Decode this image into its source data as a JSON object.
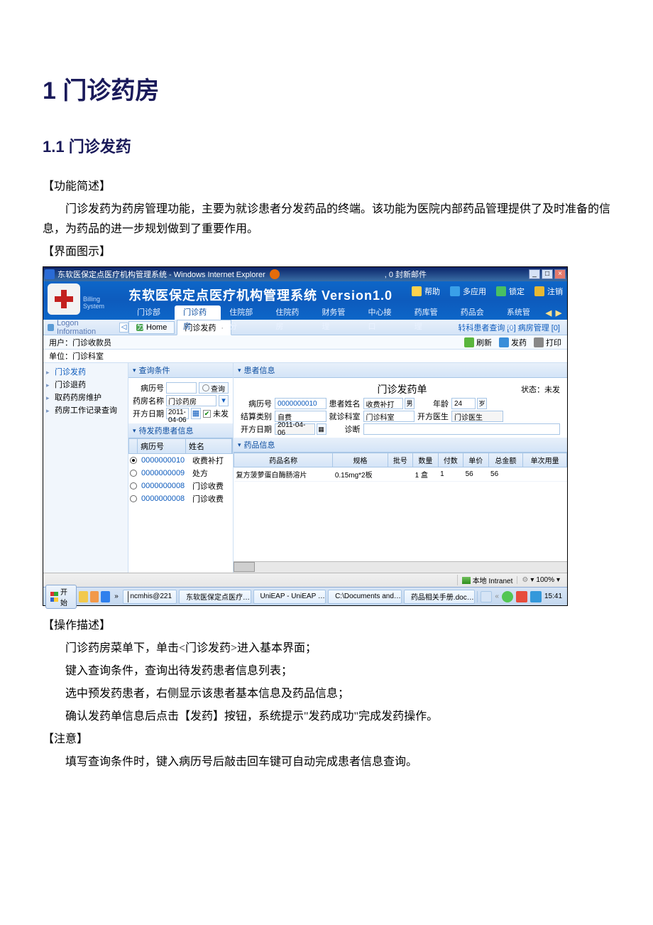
{
  "page_title": "1 门诊药房",
  "section_title": "1.1 门诊发药",
  "headings": {
    "func_intro": "【功能简述】",
    "ui_demo": "【界面图示】",
    "op_desc": "【操作描述】",
    "note": "【注意】"
  },
  "paragraphs": {
    "func_p1": "门诊发药为药房管理功能，主要为就诊患者分发药品的终端。该功能为医院内部药品管理提供了及时准备的信息，为药品的进一步规划做到了重要作用。",
    "op_1": "门诊药房菜单下，单击<门诊发药>进入基本界面；",
    "op_2": "键入查询条件，查询出待发药患者信息列表；",
    "op_3": "选中预发药患者，右侧显示该患者基本信息及药品信息；",
    "op_4": "确认发药单信息后点击【发药】按钮，系统提示\"发药成功\"完成发药操作。",
    "note_1": "填写查询条件时，键入病历号后敲击回车键可自动完成患者信息查询。"
  },
  "screenshot": {
    "titlebar": {
      "app_title": "东软医保定点医疗机构管理系统 - Windows Internet Explorer",
      "center_note": ", 0 封新邮件",
      "buttons": {
        "min": "_",
        "max": "□",
        "close": "×"
      }
    },
    "banner": {
      "billing_text1": "Billing",
      "billing_text2": "System",
      "main_title": "东软医保定点医疗机构管理系统  Version1.0",
      "actions": {
        "help": "帮助",
        "more_apps": "多应用",
        "lock": "锁定",
        "logout": "注销"
      },
      "menu": [
        "门诊部分",
        "门诊药房",
        "住院部分",
        "住院药房",
        "财务管理",
        "中心接口",
        "药库管理",
        "药品会计",
        "系统管理"
      ],
      "menu_selected_index": 1
    },
    "tabrow": {
      "logon_label": "Logon Information",
      "home_tab": "Home",
      "active_tab": "门诊发药",
      "right_links": "转科患者查询 [0]  病房管理 [0]"
    },
    "infobar": {
      "user_label": "用户：门诊收款员",
      "unit_label": "单位：门诊科室",
      "refresh": "刷新",
      "dispense": "发药",
      "print": "打印"
    },
    "sidebar": {
      "items": [
        "门诊发药",
        "门诊退药",
        "取药药房维护",
        "药房工作记录查询"
      ],
      "selected_index": 0
    },
    "query": {
      "panel_title": "查询条件",
      "q_btn": "查询",
      "labels": {
        "mrn": "病历号",
        "pharmacy": "药房名称",
        "date": "开方日期",
        "not_disp": "未发"
      },
      "values": {
        "mrn": "",
        "pharmacy": "门诊药房",
        "date": "2011-04-06",
        "not_disp_checked": true
      }
    },
    "patient_list": {
      "panel_title": "待发药患者信息",
      "headers": [
        "病历号",
        "姓名"
      ],
      "rows": [
        {
          "selected": true,
          "mrn": "0000000010",
          "name": "收费补打"
        },
        {
          "selected": false,
          "mrn": "0000000009",
          "name": "处方"
        },
        {
          "selected": false,
          "mrn": "0000000008",
          "name": "门诊收费"
        },
        {
          "selected": false,
          "mrn": "0000000008",
          "name": "门诊收费"
        }
      ]
    },
    "patient_panel": {
      "panel_title": "患者信息",
      "form_title": "门诊发药单",
      "status": "状态：未发",
      "labels": {
        "mrn": "病历号",
        "name": "患者姓名",
        "age": "年龄",
        "pay_type": "结算类别",
        "dept": "就诊科室",
        "doctor": "开方医生",
        "date": "开方日期",
        "diag": "诊断"
      },
      "values": {
        "mrn": "0000000010",
        "name": "收费补打",
        "age": "24",
        "sex": "男",
        "pay_type": "自费",
        "dept": "门诊科室",
        "doctor": "门诊医生",
        "date": "2011-04-06",
        "diag": ""
      }
    },
    "drug_panel": {
      "panel_title": "药品信息",
      "headers": [
        "药品名称",
        "规格",
        "批号",
        "数量",
        "付数",
        "单价",
        "总金额",
        "单次用量"
      ],
      "row": {
        "name": "复方菠萝蛋白酶肠溶片",
        "spec": "0.15mg*2板",
        "batch": "",
        "qty": "1 盒",
        "times": "1",
        "price": "56",
        "total": "56",
        "dose": ""
      }
    },
    "statusbar": {
      "zone": "本地 Intranet",
      "zoom": "100%"
    },
    "taskbar": {
      "start": "开始",
      "host": "ncmhis@221",
      "items": [
        "东软医保定点医疗…",
        "UniEAP - UniEAP …",
        "C:\\Documents and…",
        "药品相关手册.doc…"
      ],
      "time": "15:41"
    }
  }
}
